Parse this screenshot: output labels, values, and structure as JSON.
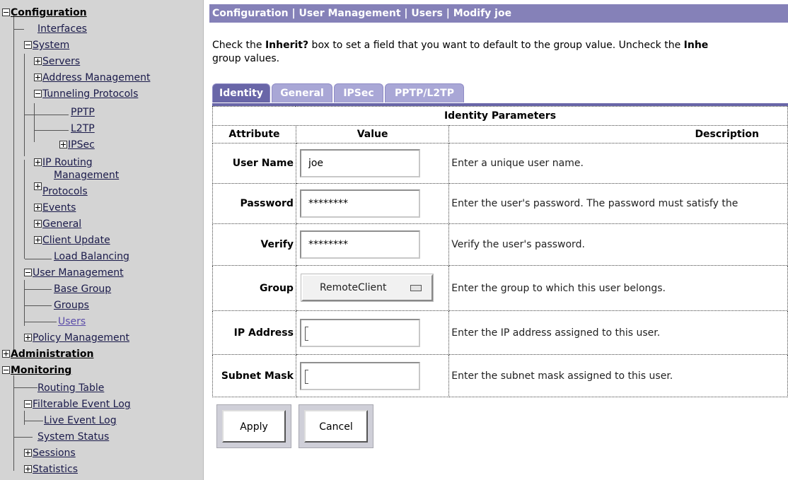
{
  "sidebar": {
    "items": [
      {
        "label": "Configuration"
      },
      {
        "label": "Interfaces"
      },
      {
        "label": "System"
      },
      {
        "label": "Servers"
      },
      {
        "label": "Address Management"
      },
      {
        "label": "Tunneling Protocols"
      },
      {
        "label": "PPTP"
      },
      {
        "label": "L2TP"
      },
      {
        "label": "IPSec"
      },
      {
        "label": "IP Routing"
      },
      {
        "label": "Management"
      },
      {
        "label": "Protocols"
      },
      {
        "label": "Events"
      },
      {
        "label": "General"
      },
      {
        "label": "Client Update"
      },
      {
        "label": "Load Balancing"
      },
      {
        "label": "User Management"
      },
      {
        "label": "Base Group"
      },
      {
        "label": "Groups"
      },
      {
        "label": "Users"
      },
      {
        "label": "Policy Management"
      },
      {
        "label": "Administration"
      },
      {
        "label": "Monitoring"
      },
      {
        "label": "Routing Table"
      },
      {
        "label": "Filterable Event Log"
      },
      {
        "label": "Live Event Log"
      },
      {
        "label": "System Status"
      },
      {
        "label": "Sessions"
      },
      {
        "label": "Statistics"
      }
    ]
  },
  "header": {
    "breadcrumb": "Configuration | User Management | Users | Modify joe"
  },
  "intro": {
    "prefix": "Check the ",
    "bold1": "Inherit?",
    "middle": " box to set a field that you want to default to the group value. Uncheck the ",
    "bold2": "Inhe",
    "line2": "group values."
  },
  "tabs": [
    {
      "label": "Identity"
    },
    {
      "label": "General"
    },
    {
      "label": "IPSec"
    },
    {
      "label": "PPTP/L2TP"
    }
  ],
  "table": {
    "title": "Identity Parameters",
    "columns": {
      "attribute": "Attribute",
      "value": "Value",
      "description": "Description"
    },
    "rows": [
      {
        "attribute": "User Name",
        "value": "joe",
        "description": "Enter a unique user name."
      },
      {
        "attribute": "Password",
        "value": "********",
        "description": "Enter the user's password. The password must satisfy the"
      },
      {
        "attribute": "Verify",
        "value": "********",
        "description": "Verify the user's password."
      },
      {
        "attribute": "Group",
        "value": "RemoteClient",
        "description": "Enter the group to which this user belongs."
      },
      {
        "attribute": "IP Address",
        "value": "",
        "description": "Enter the IP address assigned to this user."
      },
      {
        "attribute": "Subnet Mask",
        "value": "",
        "description": "Enter the subnet mask assigned to this user."
      }
    ]
  },
  "buttons": {
    "apply": "Apply",
    "cancel": "Cancel"
  },
  "colors": {
    "breadcrumb_bg": "#8581b8",
    "tab_active": "#6966a8",
    "tab_inactive": "#a9a7d6",
    "sidebar_bg": "#d4d4d4"
  }
}
